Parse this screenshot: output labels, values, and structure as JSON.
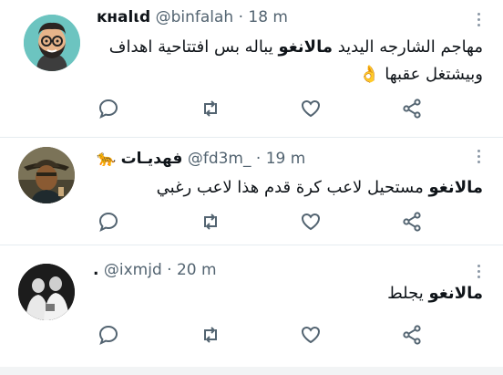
{
  "tweets": [
    {
      "name": "ĸнalιd",
      "handle": "@binfalah",
      "dot": "·",
      "time": "18 m",
      "text_line1_pre": "مهاجم الشارجه اليديد ",
      "text_line1_bold": "مالانغو",
      "text_line1_post": " يباله بس افتتاحية اهداف",
      "text_line2": "وبيشتغل عقبها 👌",
      "avatar": "cartoon-bearded-man-avatar"
    },
    {
      "name": "فهديـات",
      "name_emoji": "🐆",
      "handle": "@fd3m_",
      "dot": "·",
      "time": "19 m",
      "text_line1_bold": "مالانغو",
      "text_line1_post": " مستحيل لاعب كرة قدم هذا لاعب رغبي",
      "avatar": "man-with-hat-avatar"
    },
    {
      "name": ".",
      "handle": "@ixmjd",
      "dot": "·",
      "time": "20 m",
      "text_line1_bold": "مالانغو",
      "text_line1_post": " يجلط",
      "avatar": "black-white-group-photo-avatar"
    }
  ],
  "colors": {
    "muted": "#536471",
    "separator": "#e6ecf0",
    "text": "#0f1419"
  },
  "icons": [
    "reply-icon",
    "retweet-icon",
    "like-icon",
    "share-icon",
    "more-options-icon"
  ]
}
